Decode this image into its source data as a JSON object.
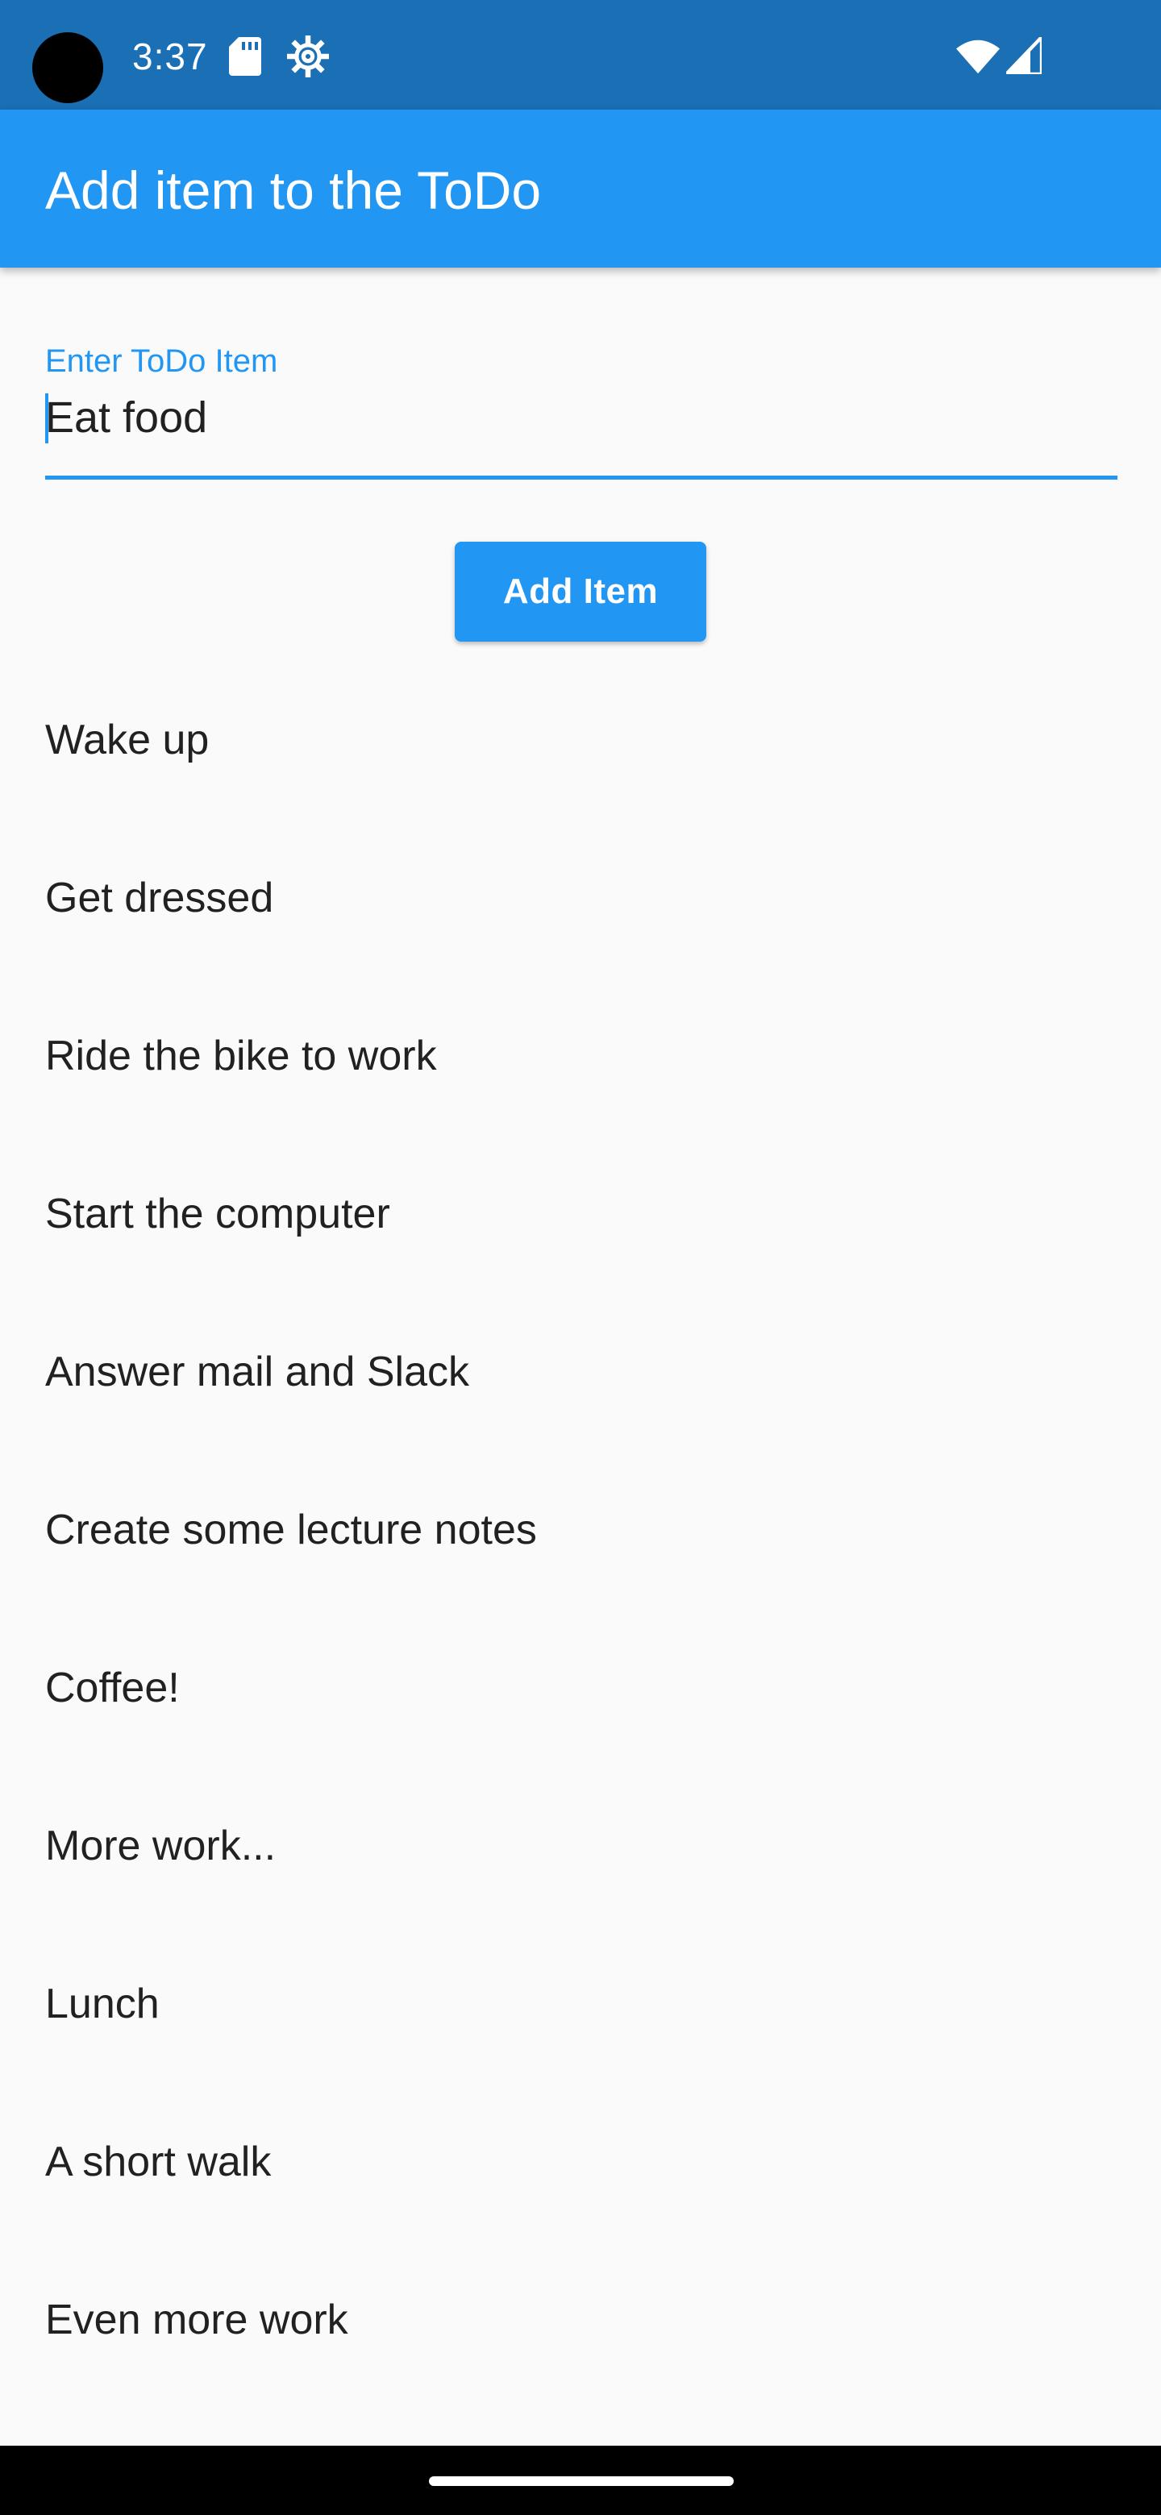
{
  "status_bar": {
    "time": "3:37",
    "icons": [
      "sd-card-icon",
      "gear-icon",
      "wifi-icon",
      "cell-signal-icon"
    ]
  },
  "app_bar": {
    "title": "Add item to the ToDo"
  },
  "form": {
    "input_label": "Enter ToDo Item",
    "input_value": "Eat food",
    "button_label": "Add Item"
  },
  "todo": {
    "items": [
      "Wake up",
      "Get dressed",
      "Ride the bike to work",
      "Start the computer",
      "Answer mail and Slack",
      "Create some lecture notes",
      "Coffee!",
      "More work...",
      "Lunch",
      "A short walk",
      "Even more work"
    ]
  },
  "colors": {
    "status_bar": "#1a6fb5",
    "primary": "#2196f3",
    "background": "#fafafa",
    "text": "#212121"
  }
}
